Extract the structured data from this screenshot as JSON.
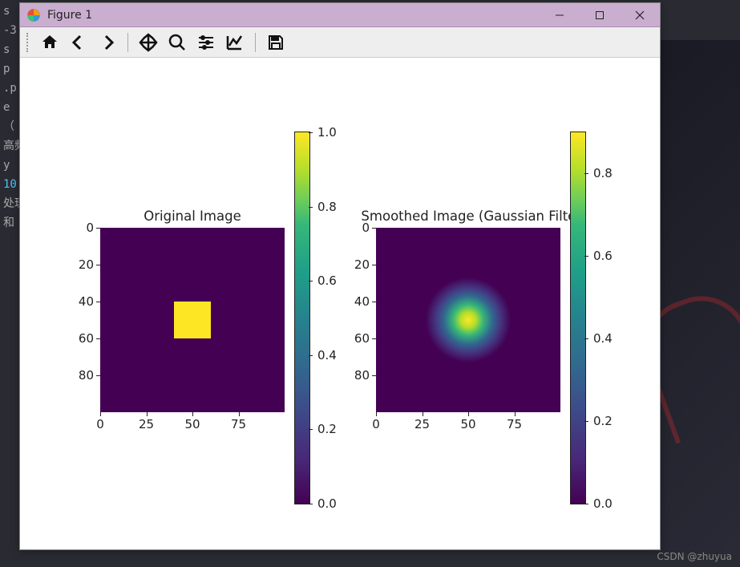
{
  "window": {
    "title": "Figure 1"
  },
  "toolbar": {
    "buttons": [
      "home",
      "back",
      "forward",
      "pan",
      "zoom",
      "configure",
      "axis-edit",
      "save"
    ]
  },
  "chart_data": [
    {
      "type": "heatmap",
      "title": "Original Image",
      "xlabel": "",
      "ylabel": "",
      "xlim": [
        0,
        99
      ],
      "ylim": [
        0,
        99
      ],
      "xticks": [
        0,
        25,
        50,
        75
      ],
      "yticks": [
        0,
        20,
        40,
        60,
        80
      ],
      "colormap": "viridis",
      "colorbar_range": [
        0.0,
        1.0
      ],
      "colorbar_ticks": [
        0.0,
        0.2,
        0.4,
        0.6,
        0.8,
        1.0
      ],
      "description": "100×100 array of zeros with a solid square of value 1.0 at rows 40–60, cols 40–60"
    },
    {
      "type": "heatmap",
      "title": "Smoothed Image (Gaussian Filter)",
      "xlabel": "",
      "ylabel": "",
      "xlim": [
        0,
        99
      ],
      "ylim": [
        0,
        99
      ],
      "xticks": [
        0,
        25,
        50,
        75
      ],
      "yticks": [
        0,
        20,
        40,
        60,
        80
      ],
      "colormap": "viridis",
      "colorbar_range": [
        0.0,
        0.9
      ],
      "colorbar_ticks": [
        0.0,
        0.2,
        0.4,
        0.6,
        0.8
      ],
      "description": "Gaussian-filtered version of the original image; radial falloff centered at (50,50), peak ≈ 0.9"
    }
  ],
  "ticks": {
    "y": [
      "0",
      "20",
      "40",
      "60",
      "80"
    ],
    "x": [
      "0",
      "25",
      "50",
      "75"
    ],
    "cb1": [
      "0.0",
      "0.2",
      "0.4",
      "0.6",
      "0.8",
      "1.0"
    ],
    "cb2": [
      "0.0",
      "0.2",
      "0.4",
      "0.6",
      "0.8"
    ]
  },
  "background_code": {
    "lines": [
      "s",
      "-3",
      "s",
      "p",
      ".p",
      "e",
      "",
      "",
      "",
      "",
      "（",
      "",
      "高频",
      "y",
      "10",
      "",
      "处理",
      "",
      "",
      "",
      "",
      "和"
    ]
  },
  "watermark": "CSDN @zhuyua"
}
